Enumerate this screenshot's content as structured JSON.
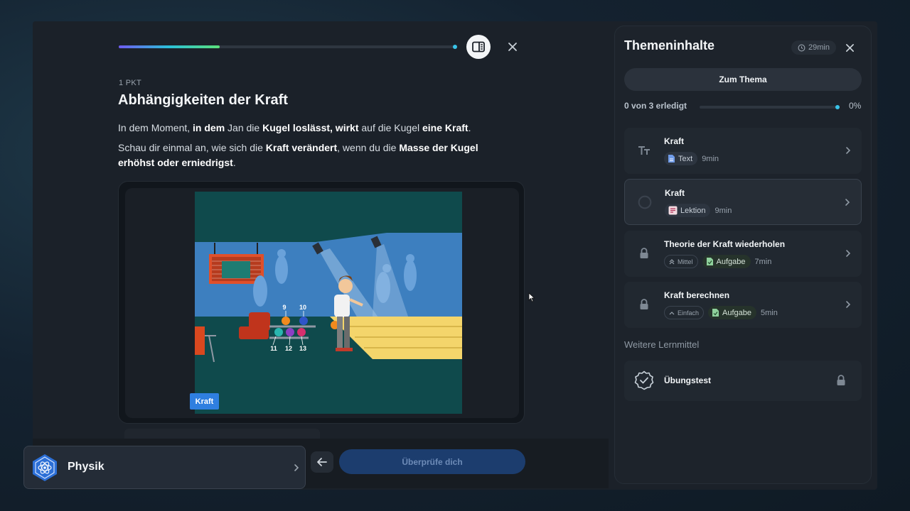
{
  "exercise": {
    "progress_fraction": 0.3,
    "points": "1 PKT",
    "title": "Abhängigkeiten der Kraft",
    "p1": {
      "t1": "In dem Moment, ",
      "b1": "in dem",
      "t2": " Jan die ",
      "b2": "Kugel loslässt, wirkt",
      "t3": " auf die Kugel ",
      "b3": "eine Kraft",
      "t4": "."
    },
    "p2": {
      "t1": "Schau dir einmal an, wie sich die ",
      "b1": "Kraft verändert",
      "t2": ", wenn du die ",
      "b2": "Masse der Kugel erhöhst oder erniedrigst",
      "t3": "."
    },
    "media": {
      "pin_labels_top": [
        "9",
        "10"
      ],
      "pin_labels_bottom": [
        "11",
        "12",
        "13"
      ],
      "kraft_button": "Kraft"
    },
    "back_icon": "arrow-left-icon",
    "check_button": "Überprüfe dich"
  },
  "subject_card": {
    "label": "Physik",
    "icon": "atom-icon"
  },
  "side_panel": {
    "title": "Themeninhalte",
    "duration": "29min",
    "zum_thema": "Zum Thema",
    "done_label": "0 von 3 erledigt",
    "done_percent": "0%",
    "lessons": [
      {
        "title": "Kraft",
        "tag": "Text",
        "mins": "9min",
        "icon": "text-size-icon"
      },
      {
        "title": "Kraft",
        "tag": "Lektion",
        "mins": "9min",
        "icon": "progress-circle-icon"
      },
      {
        "title": "Theorie der Kraft wiederholen",
        "level": "Mittel",
        "tag": "Aufgabe",
        "mins": "7min",
        "icon": "lock-icon"
      },
      {
        "title": "Kraft berechnen",
        "level": "Einfach",
        "tag": "Aufgabe",
        "mins": "5min",
        "icon": "lock-icon"
      }
    ],
    "weitere": "Weitere Lernmittel",
    "uebungstest": "Übungstest"
  },
  "colors": {
    "accent_blue": "#2f7fe0",
    "progress_start": "#6f5bf0",
    "progress_end": "#5be07a",
    "panel_bg": "#1d232b"
  }
}
